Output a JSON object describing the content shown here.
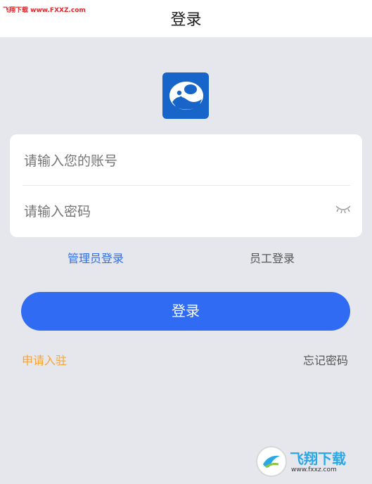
{
  "watermark_top": "飞翔下载 www.FXXZ.com",
  "header": {
    "title": "登录"
  },
  "logo": {
    "name": "elephant-logo-icon",
    "color": "#1765c9"
  },
  "form": {
    "account_placeholder": "请输入您的账号",
    "password_placeholder": "请输入密码",
    "eye_icon": "eye-closed-icon"
  },
  "tabs": {
    "admin_label": "管理员登录",
    "staff_label": "员工登录",
    "active": "admin"
  },
  "actions": {
    "login_label": "登录",
    "apply_label": "申请入驻",
    "forgot_label": "忘记密码"
  },
  "watermark_badge": {
    "title": "飞翔下载",
    "url": "www.fxxz.com"
  },
  "colors": {
    "background": "#e6e7ec",
    "primary": "#2f6cf3",
    "active_tab": "#2f6fe8",
    "apply_link": "#f3a43d"
  }
}
